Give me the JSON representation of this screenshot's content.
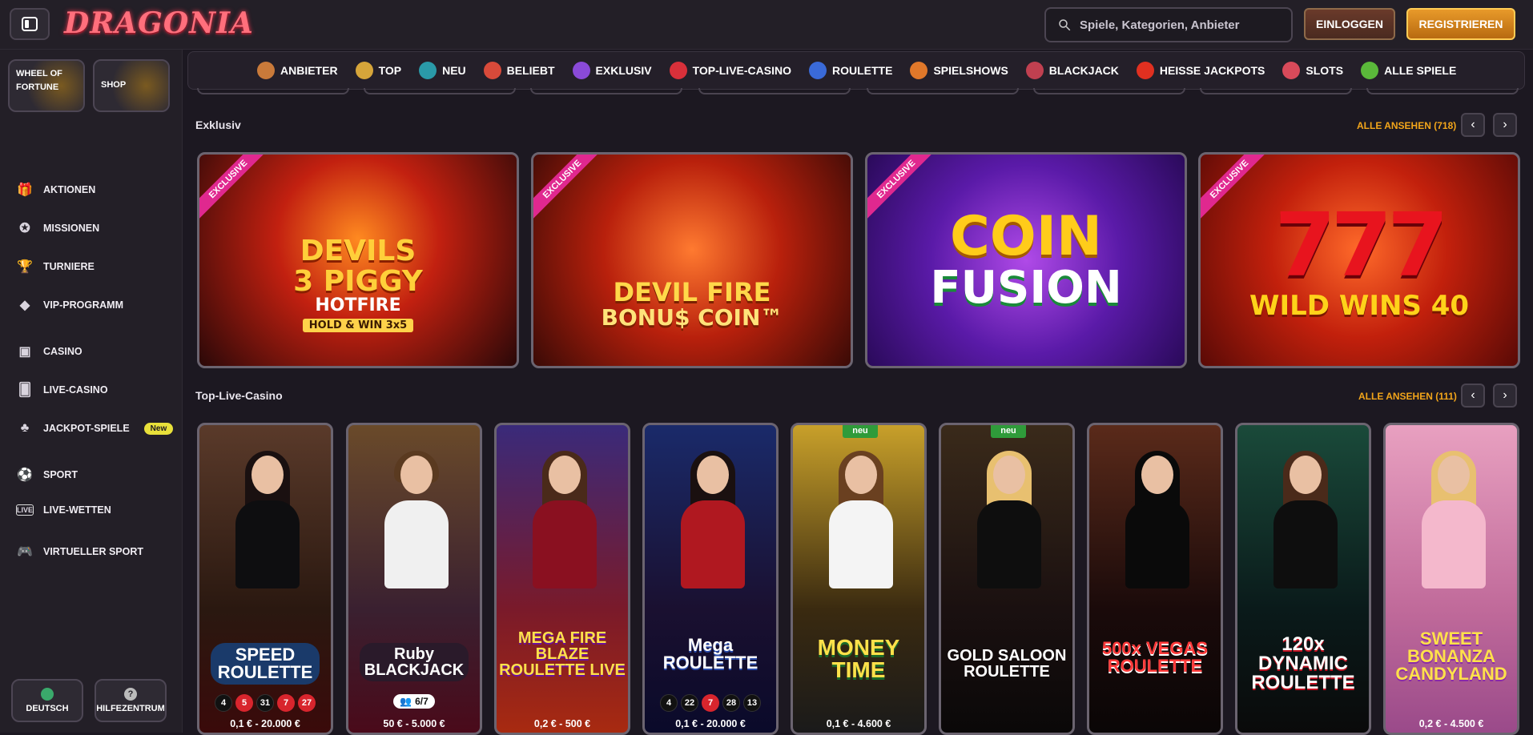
{
  "brand": {
    "logo_text": "DRAGONIA"
  },
  "header": {
    "search_placeholder": "Spiele, Kategorien, Anbieter",
    "login_label": "EINLOGGEN",
    "register_label": "REGISTRIEREN"
  },
  "sidebar": {
    "promos": [
      {
        "label": "WHEEL OF FORTUNE",
        "icon": "wheel-icon"
      },
      {
        "label": "SHOP",
        "icon": "shop-icon"
      }
    ],
    "items": [
      {
        "label": "AKTIONEN",
        "icon": "gift-icon"
      },
      {
        "label": "MISSIONEN",
        "icon": "mission-icon"
      },
      {
        "label": "TURNIERE",
        "icon": "trophy-icon"
      },
      {
        "label": "VIP-PROGRAMM",
        "icon": "diamond-icon"
      },
      {
        "label": "CASINO",
        "icon": "slot-machine-icon"
      },
      {
        "label": "LIVE-CASINO",
        "icon": "cards-icon"
      },
      {
        "label": "JACKPOT-SPIELE",
        "icon": "clover-icon",
        "badge": "New"
      },
      {
        "label": "SPORT",
        "icon": "ball-icon"
      },
      {
        "label": "LIVE-WETTEN",
        "icon": "live-icon"
      },
      {
        "label": "VIRTUELLER SPORT",
        "icon": "gamepad-icon"
      }
    ],
    "footer": {
      "language_label": "DEUTSCH",
      "help_label": "HILFEZENTRUM"
    }
  },
  "categories": [
    {
      "label": "ANBIETER",
      "color": "#c97a3a"
    },
    {
      "label": "TOP",
      "color": "#d6a53a"
    },
    {
      "label": "NEU",
      "color": "#2a9aa8"
    },
    {
      "label": "BELIEBT",
      "color": "#d84a3a"
    },
    {
      "label": "EXKLUSIV",
      "color": "#8a4ad8"
    },
    {
      "label": "TOP-LIVE-CASINO",
      "color": "#d8303a"
    },
    {
      "label": "ROULETTE",
      "color": "#3a6ad8"
    },
    {
      "label": "SPIELSHOWS",
      "color": "#e0782a"
    },
    {
      "label": "BLACKJACK",
      "color": "#c04050"
    },
    {
      "label": "HEISSE JACKPOTS",
      "color": "#e03020"
    },
    {
      "label": "SLOTS",
      "color": "#d84a5a"
    },
    {
      "label": "ALLE SPIELE",
      "color": "#5ab83a"
    }
  ],
  "exclusive": {
    "title": "Exklusiv",
    "see_all": "ALLE ANSEHEN (718)",
    "cards": [
      {
        "ribbon": "EXCLUSIVE",
        "title_lines": [
          "DEVILS",
          "3 PIGGY",
          "HOTFIRE"
        ],
        "subtitle": "HOLD & WIN 3x5"
      },
      {
        "ribbon": "EXCLUSIVE",
        "title_lines": [
          "DEVIL FIRE",
          "BONU$ COIN™"
        ],
        "subtitle": ""
      },
      {
        "ribbon": "EXCLUSIVE",
        "title_lines": [
          "COIN",
          "FUSION"
        ],
        "subtitle": ""
      },
      {
        "ribbon": "EXCLUSIVE",
        "title_lines": [
          "777",
          "WILD WINS 40"
        ],
        "subtitle": ""
      }
    ]
  },
  "live": {
    "title": "Top-Live-Casino",
    "see_all": "ALLE ANSEHEN (111)",
    "cards": [
      {
        "logo": "SPEED ROULETTE",
        "price": "0,1 € - 20.000 €",
        "numbers": [
          {
            "n": "4",
            "c": "black"
          },
          {
            "n": "5",
            "c": "red"
          },
          {
            "n": "31",
            "c": "black"
          },
          {
            "n": "7",
            "c": "red"
          },
          {
            "n": "27",
            "c": "red"
          }
        ],
        "badge": ""
      },
      {
        "logo": "Ruby BLACKJACK",
        "price": "50 € - 5.000 €",
        "players": "6/7",
        "badge": ""
      },
      {
        "logo": "MEGA FIRE BLAZE ROULETTE LIVE",
        "price": "0,2 € - 500 €",
        "badge": ""
      },
      {
        "logo": "Mega ROULETTE",
        "price": "0,1 € - 20.000 €",
        "numbers": [
          {
            "n": "4",
            "c": "black"
          },
          {
            "n": "22",
            "c": "black"
          },
          {
            "n": "7",
            "c": "red"
          },
          {
            "n": "28",
            "c": "black"
          },
          {
            "n": "13",
            "c": "black"
          }
        ],
        "badge": ""
      },
      {
        "logo": "MONEY TIME",
        "price": "0,1 € - 4.600 €",
        "badge": "neu"
      },
      {
        "logo": "GOLD SALOON ROULETTE",
        "price": "",
        "badge": "neu"
      },
      {
        "logo": "500x VEGAS ROULETTE",
        "price": "",
        "badge": ""
      },
      {
        "logo": "120x DYNAMIC ROULETTE",
        "price": "",
        "badge": ""
      },
      {
        "logo": "SWEET BONANZA CANDYLAND",
        "price": "0,2 € - 4.500 €",
        "badge": ""
      }
    ]
  }
}
